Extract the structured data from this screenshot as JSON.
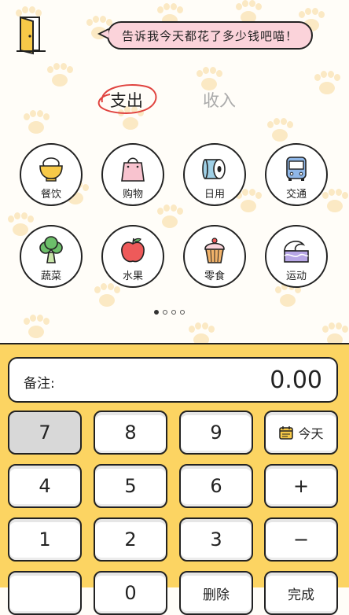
{
  "header": {
    "speech": "告诉我今天都花了多少钱吧喵！"
  },
  "tabs": {
    "expense": "支出",
    "income": "收入"
  },
  "categories": [
    {
      "label": "餐饮",
      "icon": "rice-bowl-icon"
    },
    {
      "label": "购物",
      "icon": "shopping-bag-icon"
    },
    {
      "label": "日用",
      "icon": "toilet-paper-icon"
    },
    {
      "label": "交通",
      "icon": "bus-icon"
    },
    {
      "label": "蔬菜",
      "icon": "broccoli-icon"
    },
    {
      "label": "水果",
      "icon": "apple-icon"
    },
    {
      "label": "零食",
      "icon": "cupcake-icon"
    },
    {
      "label": "运动",
      "icon": "surf-wave-icon"
    }
  ],
  "pager": {
    "total": 4,
    "active": 0
  },
  "input": {
    "note_label": "备注:",
    "amount": "0.00"
  },
  "keys": {
    "k7": "7",
    "k8": "8",
    "k9": "9",
    "today": "今天",
    "k4": "4",
    "k5": "5",
    "k6": "6",
    "plus": "+",
    "k1": "1",
    "k2": "2",
    "k3": "3",
    "minus": "−",
    "k0": "0",
    "delete": "删除",
    "done": "完成"
  },
  "colors": {
    "accent_yellow": "#fcd462",
    "bubble_pink": "#fbd3da",
    "paw": "#fbe9c4",
    "pen_red": "#e0433f"
  }
}
